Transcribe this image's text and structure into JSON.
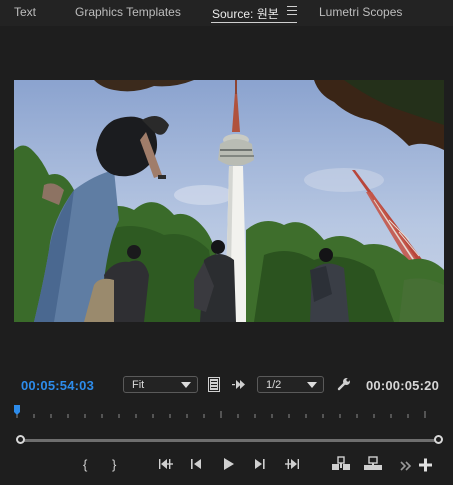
{
  "tabs": [
    {
      "label": "Text"
    },
    {
      "label": "Graphics Templates"
    },
    {
      "label": "Source: 원본"
    },
    {
      "label": "Lumetri Scopes"
    }
  ],
  "timecode": {
    "current": "00:05:54:03",
    "duration": "00:00:05:20",
    "current_color": "#2d8ceb"
  },
  "controls": {
    "fit_value": "Fit",
    "resolution_value": "1/2"
  },
  "icons": [
    "panel-menu-icon",
    "export-frame-icon",
    "settings-icon",
    "mark-in-icon",
    "mark-out-icon",
    "go-to-in-icon",
    "step-back-icon",
    "play-icon",
    "step-forward-icon",
    "go-to-out-icon",
    "insert-icon",
    "overwrite-icon",
    "more-icon",
    "add-button-icon"
  ]
}
